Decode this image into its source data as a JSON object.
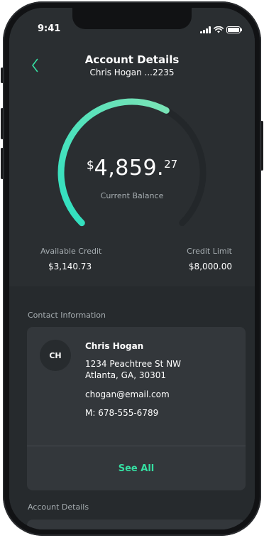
{
  "status_bar": {
    "time": "9:41"
  },
  "header": {
    "title": "Account Details",
    "subtitle": "Chris Hogan ...2235",
    "back_icon": "chevron-left-icon"
  },
  "balance": {
    "currency_symbol": "$",
    "whole": "4,859.",
    "cents": "27",
    "label": "Current Balance"
  },
  "credit": {
    "available_label": "Available Credit",
    "available_value": "$3,140.73",
    "limit_label": "Credit Limit",
    "limit_value": "$8,000.00",
    "utilization": 0.607
  },
  "contact": {
    "section_label": "Contact Information",
    "initials": "CH",
    "name": "Chris Hogan",
    "address_line1": "1234 Peachtree St NW",
    "address_line2": "Atlanta, GA, 30301",
    "email": "chogan@email.com",
    "phone": "M: 678-555-6789",
    "see_all_label": "See All"
  },
  "account_section": {
    "label": "Account Details"
  },
  "colors": {
    "accent": "#35dfa2",
    "gauge_start": "#2de0c0",
    "gauge_end": "#7be3b6",
    "gauge_track": "#23272a",
    "screen_bg": "#2a2e31",
    "card_bg": "#33373b"
  }
}
